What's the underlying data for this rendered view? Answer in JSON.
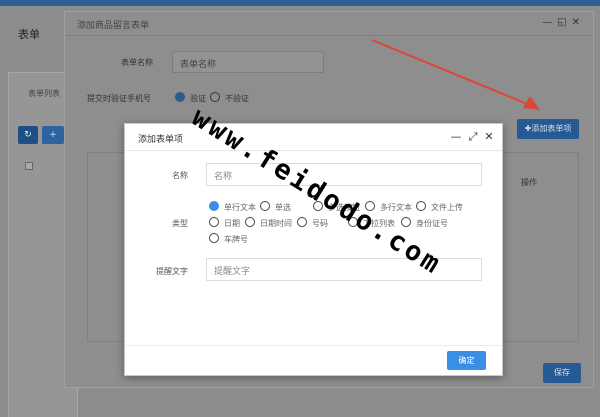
{
  "background": {
    "page_title": "表单",
    "tab_label": "表单列表",
    "refresh_glyph": "↻",
    "add_glyph": "+"
  },
  "outer_modal": {
    "title": "添加商品留言表单",
    "controls": "—◱✕",
    "form_name_label": "表单名称",
    "form_name_placeholder": "表单名称",
    "verify_label": "提交时验证手机号",
    "verify_on": "验证",
    "verify_off": "不验证",
    "add_item_button": "✚添加表单项",
    "op_column": "操作",
    "save_button": "保存"
  },
  "inner_modal": {
    "title": "添加表单项",
    "controls": {
      "minimize": "—",
      "maximize": "⤢",
      "close": "✕"
    },
    "name_label": "名称",
    "name_placeholder": "名称",
    "type_label": "类型",
    "types_row1": [
      "单行文本",
      "单选",
      "多选按钮",
      "多行文本",
      "文件上传"
    ],
    "types_row2": [
      "日期",
      "日期时间",
      "号码",
      "下拉列表",
      "身份证号"
    ],
    "types_row3": [
      "车牌号"
    ],
    "selected_type": "单行文本",
    "hint_label": "提醒文字",
    "hint_placeholder": "提醒文字",
    "confirm_button": "确定"
  },
  "watermark": {
    "text": "www.feidodo.com",
    "color": "#000000"
  },
  "colors": {
    "primary": "#3a8ee6",
    "arrow": "#e0453a"
  }
}
